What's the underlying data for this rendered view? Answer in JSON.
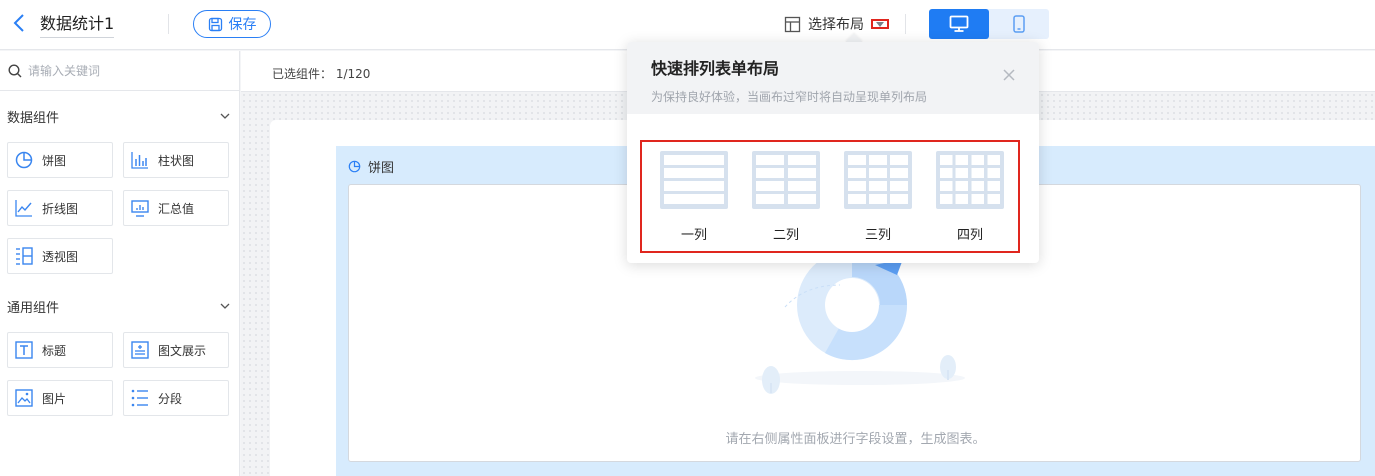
{
  "header": {
    "title": "数据统计1",
    "save_label": "保存",
    "layout_label": "选择布局"
  },
  "sidebar": {
    "search_placeholder": "请输入关键词",
    "groups": [
      {
        "label": "数据组件",
        "items": [
          {
            "label": "饼图",
            "icon": "pie-chart-icon"
          },
          {
            "label": "柱状图",
            "icon": "bar-chart-icon"
          },
          {
            "label": "折线图",
            "icon": "line-chart-icon"
          },
          {
            "label": "汇总值",
            "icon": "summary-icon"
          },
          {
            "label": "透视图",
            "icon": "pivot-icon"
          }
        ]
      },
      {
        "label": "通用组件",
        "items": [
          {
            "label": "标题",
            "icon": "title-icon"
          },
          {
            "label": "图文展示",
            "icon": "rich-text-icon"
          },
          {
            "label": "图片",
            "icon": "image-icon"
          },
          {
            "label": "分段",
            "icon": "segment-icon"
          }
        ]
      }
    ]
  },
  "canvas": {
    "selected_label": "已选组件：",
    "selected_count": "1/120",
    "widget_title": "饼图",
    "empty_text": "请在右侧属性面板进行字段设置，生成图表。"
  },
  "popover": {
    "title": "快速排列表单布局",
    "subtitle": "为保持良好体验，当画布过窄时将自动呈现单列布局",
    "options": [
      {
        "label": "一列",
        "columns": 1
      },
      {
        "label": "二列",
        "columns": 2
      },
      {
        "label": "三列",
        "columns": 3
      },
      {
        "label": "四列",
        "columns": 4
      }
    ]
  },
  "colors": {
    "primary": "#1f7cf3",
    "highlight_border": "#e0261e",
    "chart_panel_bg": "#d7ebfd"
  }
}
